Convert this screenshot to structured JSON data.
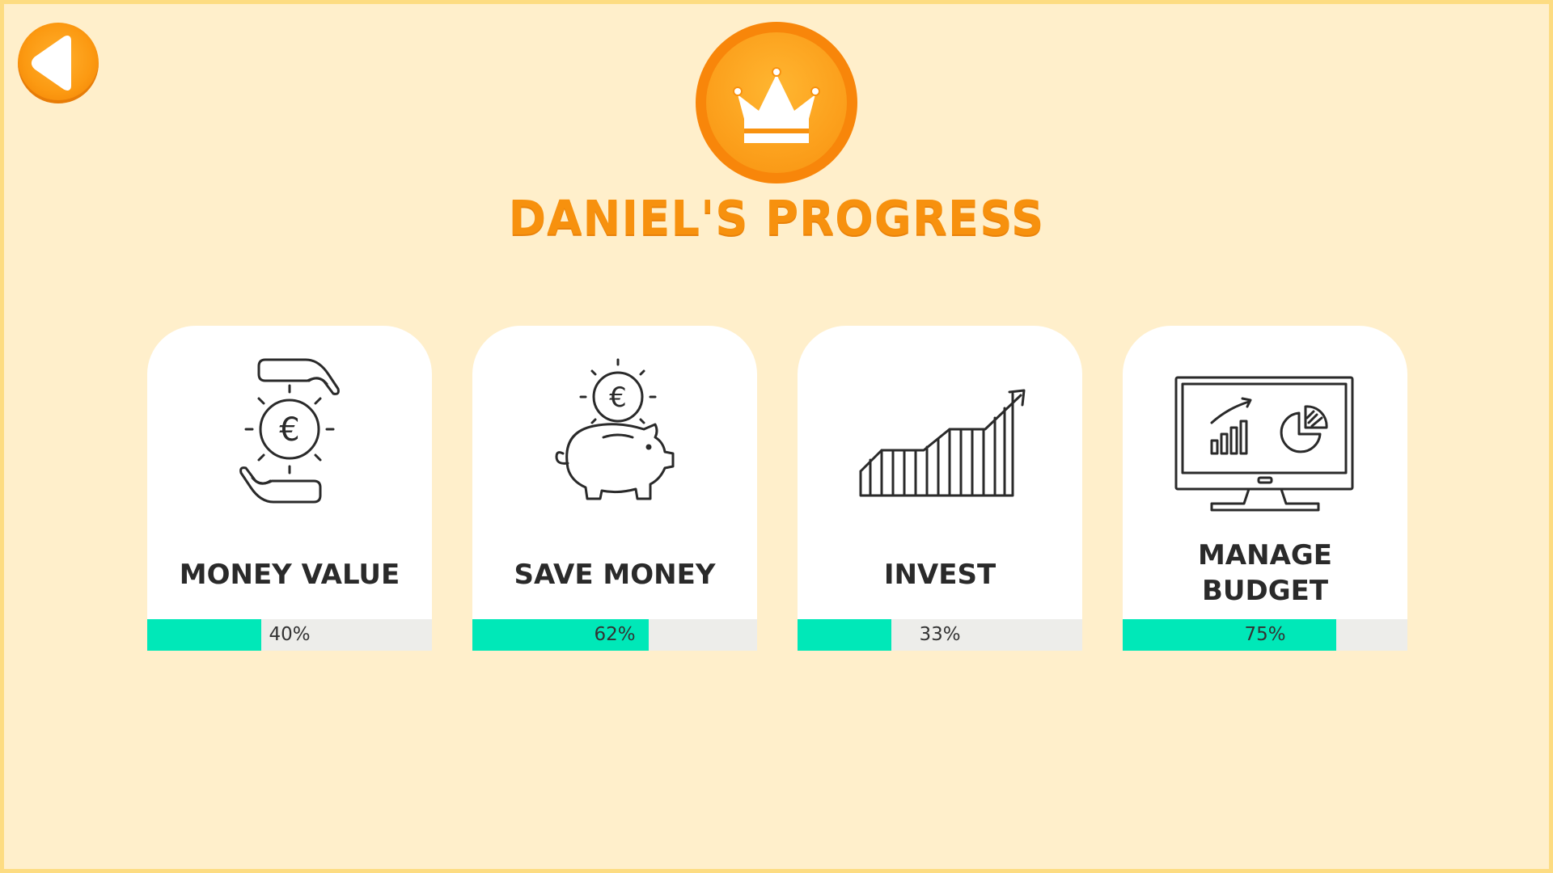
{
  "header": {
    "title": "DANIEL'S PROGRESS",
    "back_icon": "back-arrow-icon",
    "badge_icon": "crown-icon"
  },
  "colors": {
    "background": "#FFEFCB",
    "accent_orange": "#F7910E",
    "progress_fill": "#00E8B8",
    "progress_track": "#EDEDEA"
  },
  "cards": [
    {
      "label": "MONEY VALUE",
      "icon": "hands-euro-coin-icon",
      "progress": 40,
      "progress_text": "40%"
    },
    {
      "label": "SAVE MONEY",
      "icon": "piggy-bank-euro-icon",
      "progress": 62,
      "progress_text": "62%"
    },
    {
      "label": "INVEST",
      "icon": "growth-chart-icon",
      "progress": 33,
      "progress_text": "33%"
    },
    {
      "label_line1": "MANAGE",
      "label_line2": "BUDGET",
      "icon": "monitor-charts-icon",
      "progress": 75,
      "progress_text": "75%"
    }
  ]
}
